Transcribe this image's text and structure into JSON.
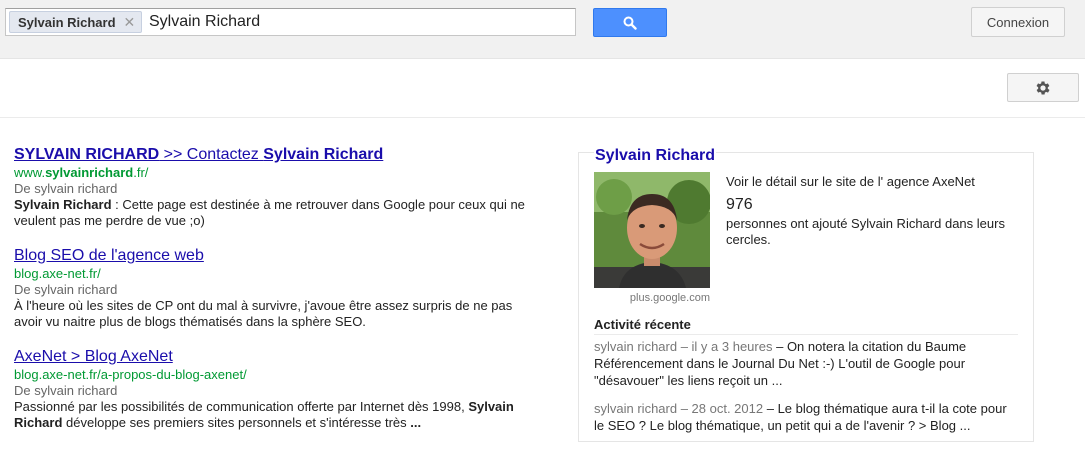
{
  "search": {
    "chip_label": "Sylvain Richard",
    "chip_remove": "✕",
    "query": "Sylvain Richard"
  },
  "header": {
    "signin_label": "Connexion"
  },
  "results": [
    {
      "title_parts": [
        {
          "text": "SYLVAIN RICHARD",
          "bold": true
        },
        {
          "text": " >> Contactez ",
          "bold": false
        },
        {
          "text": "Sylvain Richard",
          "bold": true
        }
      ],
      "url_parts": [
        {
          "text": "www.",
          "bold": false
        },
        {
          "text": "sylvainrichard",
          "bold": true
        },
        {
          "text": ".fr/",
          "bold": false
        }
      ],
      "author": "De sylvain richard",
      "snippet_parts": [
        {
          "text": "Sylvain Richard",
          "bold": true
        },
        {
          "text": " : Cette page est destinée à me retrouver dans Google pour ceux qui ne veulent pas me perdre de vue ;o)",
          "bold": false
        }
      ]
    },
    {
      "title_parts": [
        {
          "text": "Blog SEO de l'agence web",
          "bold": false
        }
      ],
      "url_parts": [
        {
          "text": "blog.axe-net.fr/",
          "bold": false
        }
      ],
      "author": "De sylvain richard",
      "snippet_parts": [
        {
          "text": "À l'heure où les sites de CP ont du mal à survivre, j'avoue être assez surpris de ne pas avoir vu naitre plus de blogs thématisés dans la sphère SEO.",
          "bold": false
        }
      ]
    },
    {
      "title_parts": [
        {
          "text": "AxeNet > Blog AxeNet",
          "bold": false
        }
      ],
      "url_parts": [
        {
          "text": "blog.axe-net.fr/a-propos-du-blog-axenet/",
          "bold": false
        }
      ],
      "author": "De sylvain richard",
      "snippet_parts": [
        {
          "text": "Passionné par les possibilités de communication offerte par Internet dès 1998, ",
          "bold": false
        },
        {
          "text": "Sylvain Richard",
          "bold": true
        },
        {
          "text": " développe ses premiers sites personnels et s'intéresse très ",
          "bold": false
        },
        {
          "text": "...",
          "bold": true
        }
      ]
    }
  ],
  "panel": {
    "title": "Sylvain Richard",
    "photo_source": "plus.google.com",
    "detail_link": "Voir le détail sur le site de l' agence AxeNet",
    "count": "976",
    "count_text": "personnes ont ajouté Sylvain Richard dans leurs cercles.",
    "activity_heading": "Activité récente",
    "activities": [
      {
        "meta": "sylvain richard – il y a 3 heures",
        "text": " – On notera la citation du Baume Référencement dans le Journal Du Net :-) L'outil de Google pour \"désavouer\" les liens reçoit un ..."
      },
      {
        "meta": "sylvain richard – 28 oct. 2012",
        "text": " – Le blog thématique aura t-il la cote pour le SEO ? Le blog thématique, un petit qui a de l'avenir ? > Blog ..."
      }
    ]
  },
  "colors": {
    "link": "#1a0dab",
    "url_green": "#093",
    "search_blue": "#4d90fe",
    "header_bg": "#f1f1f1"
  },
  "icons": {
    "search": "magnifier-icon",
    "settings": "gear-icon",
    "remove": "close-icon"
  }
}
